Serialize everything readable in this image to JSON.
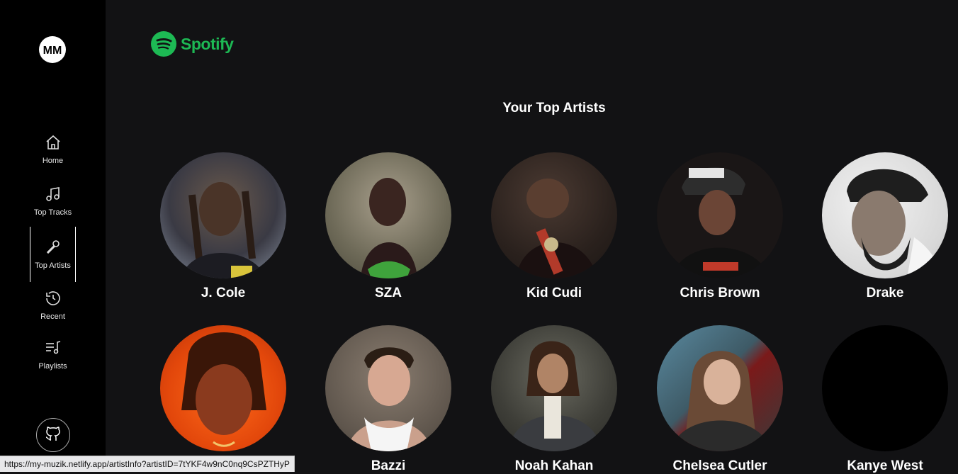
{
  "sidebar": {
    "logo_text": "MM",
    "items": [
      {
        "label": "Home",
        "icon": "home-icon"
      },
      {
        "label": "Top Tracks",
        "icon": "music-note-icon"
      },
      {
        "label": "Top Artists",
        "icon": "microphone-icon"
      },
      {
        "label": "Recent",
        "icon": "history-icon"
      },
      {
        "label": "Playlists",
        "icon": "playlist-icon"
      }
    ],
    "github_icon": "github-icon"
  },
  "brand": {
    "name": "Spotify",
    "color": "#1db954"
  },
  "main": {
    "title": "Your Top Artists",
    "artists": [
      {
        "name": "J. Cole"
      },
      {
        "name": "SZA"
      },
      {
        "name": "Kid Cudi"
      },
      {
        "name": "Chris Brown"
      },
      {
        "name": "Drake"
      },
      {
        "name": ""
      },
      {
        "name": "Bazzi"
      },
      {
        "name": "Noah Kahan"
      },
      {
        "name": "Chelsea Cutler"
      },
      {
        "name": "Kanye West"
      }
    ]
  },
  "status_bar": {
    "url": "https://my-muzik.netlify.app/artistInfo?artistID=7tYKF4w9nC0nq9CsPZTHyP"
  }
}
